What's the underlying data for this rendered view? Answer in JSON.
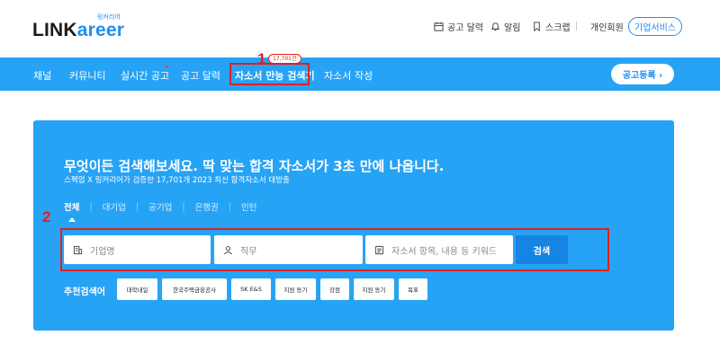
{
  "brand": {
    "logo_main": "LINK",
    "logo_accent": "areer",
    "logo_sub": "링커리어"
  },
  "header_utils": {
    "calendar_label": "공고 달력",
    "alarm_label": "알림",
    "scrap_label": "스크랩",
    "personal_label": "개인회원",
    "corp_button": "기업서비스"
  },
  "nav": {
    "items": [
      "채널",
      "커뮤니티",
      "실시간 공고",
      "공고 달력",
      "자소서 만능 검색기",
      "자소서 작성"
    ],
    "active_index": 4,
    "count_badge": "17,701건",
    "post_button": "공고등록 ›"
  },
  "annotations": {
    "marker_1": "1",
    "marker_2": "2",
    "highlight_color": "#e02020"
  },
  "search_panel": {
    "title": "무엇이든 검색해보세요. 딱 맞는 합격 자소서가 3초 만에 나옵니다.",
    "subtitle": "스펙업 X 링커리어가 검증한 17,701개 2023 최신 합격자소서 대방출",
    "tabs": [
      "전체",
      "대기업",
      "공기업",
      "은행권",
      "인턴"
    ],
    "active_tab": 0,
    "fields": {
      "company_placeholder": "기업명",
      "job_placeholder": "직무",
      "keyword_placeholder": "자소서 항목, 내용 등 키워드"
    },
    "search_button": "검색",
    "recommend_label": "추천검색어",
    "recommend_chips": [
      "대학내일",
      "한국주택금융공사",
      "SK E&S",
      "지원 동기",
      "강점",
      "지원 동기",
      "목표"
    ]
  },
  "colors": {
    "brand_blue": "#27a3f5",
    "button_blue": "#1684e3",
    "accent": "#1f8ef1"
  }
}
